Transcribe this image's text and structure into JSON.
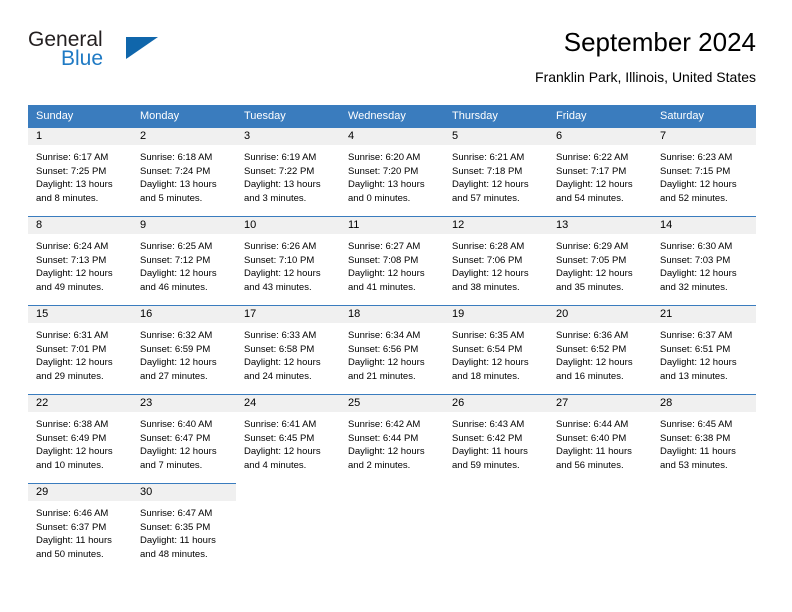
{
  "brand": {
    "name_part1": "General",
    "name_part2": "Blue",
    "triangle_color": "#1066ab",
    "blue_color": "#1f7ac4"
  },
  "header": {
    "title": "September 2024",
    "location": "Franklin Park, Illinois, United States"
  },
  "theme": {
    "header_bg": "#3a7cbe",
    "daynum_bg": "#f0f0f0",
    "cell_bg": "#ffffff",
    "text": "#000000"
  },
  "weekdays": [
    "Sunday",
    "Monday",
    "Tuesday",
    "Wednesday",
    "Thursday",
    "Friday",
    "Saturday"
  ],
  "weeks": [
    [
      {
        "day": "1",
        "sunrise": "Sunrise: 6:17 AM",
        "sunset": "Sunset: 7:25 PM",
        "daylight1": "Daylight: 13 hours",
        "daylight2": "and 8 minutes."
      },
      {
        "day": "2",
        "sunrise": "Sunrise: 6:18 AM",
        "sunset": "Sunset: 7:24 PM",
        "daylight1": "Daylight: 13 hours",
        "daylight2": "and 5 minutes."
      },
      {
        "day": "3",
        "sunrise": "Sunrise: 6:19 AM",
        "sunset": "Sunset: 7:22 PM",
        "daylight1": "Daylight: 13 hours",
        "daylight2": "and 3 minutes."
      },
      {
        "day": "4",
        "sunrise": "Sunrise: 6:20 AM",
        "sunset": "Sunset: 7:20 PM",
        "daylight1": "Daylight: 13 hours",
        "daylight2": "and 0 minutes."
      },
      {
        "day": "5",
        "sunrise": "Sunrise: 6:21 AM",
        "sunset": "Sunset: 7:18 PM",
        "daylight1": "Daylight: 12 hours",
        "daylight2": "and 57 minutes."
      },
      {
        "day": "6",
        "sunrise": "Sunrise: 6:22 AM",
        "sunset": "Sunset: 7:17 PM",
        "daylight1": "Daylight: 12 hours",
        "daylight2": "and 54 minutes."
      },
      {
        "day": "7",
        "sunrise": "Sunrise: 6:23 AM",
        "sunset": "Sunset: 7:15 PM",
        "daylight1": "Daylight: 12 hours",
        "daylight2": "and 52 minutes."
      }
    ],
    [
      {
        "day": "8",
        "sunrise": "Sunrise: 6:24 AM",
        "sunset": "Sunset: 7:13 PM",
        "daylight1": "Daylight: 12 hours",
        "daylight2": "and 49 minutes."
      },
      {
        "day": "9",
        "sunrise": "Sunrise: 6:25 AM",
        "sunset": "Sunset: 7:12 PM",
        "daylight1": "Daylight: 12 hours",
        "daylight2": "and 46 minutes."
      },
      {
        "day": "10",
        "sunrise": "Sunrise: 6:26 AM",
        "sunset": "Sunset: 7:10 PM",
        "daylight1": "Daylight: 12 hours",
        "daylight2": "and 43 minutes."
      },
      {
        "day": "11",
        "sunrise": "Sunrise: 6:27 AM",
        "sunset": "Sunset: 7:08 PM",
        "daylight1": "Daylight: 12 hours",
        "daylight2": "and 41 minutes."
      },
      {
        "day": "12",
        "sunrise": "Sunrise: 6:28 AM",
        "sunset": "Sunset: 7:06 PM",
        "daylight1": "Daylight: 12 hours",
        "daylight2": "and 38 minutes."
      },
      {
        "day": "13",
        "sunrise": "Sunrise: 6:29 AM",
        "sunset": "Sunset: 7:05 PM",
        "daylight1": "Daylight: 12 hours",
        "daylight2": "and 35 minutes."
      },
      {
        "day": "14",
        "sunrise": "Sunrise: 6:30 AM",
        "sunset": "Sunset: 7:03 PM",
        "daylight1": "Daylight: 12 hours",
        "daylight2": "and 32 minutes."
      }
    ],
    [
      {
        "day": "15",
        "sunrise": "Sunrise: 6:31 AM",
        "sunset": "Sunset: 7:01 PM",
        "daylight1": "Daylight: 12 hours",
        "daylight2": "and 29 minutes."
      },
      {
        "day": "16",
        "sunrise": "Sunrise: 6:32 AM",
        "sunset": "Sunset: 6:59 PM",
        "daylight1": "Daylight: 12 hours",
        "daylight2": "and 27 minutes."
      },
      {
        "day": "17",
        "sunrise": "Sunrise: 6:33 AM",
        "sunset": "Sunset: 6:58 PM",
        "daylight1": "Daylight: 12 hours",
        "daylight2": "and 24 minutes."
      },
      {
        "day": "18",
        "sunrise": "Sunrise: 6:34 AM",
        "sunset": "Sunset: 6:56 PM",
        "daylight1": "Daylight: 12 hours",
        "daylight2": "and 21 minutes."
      },
      {
        "day": "19",
        "sunrise": "Sunrise: 6:35 AM",
        "sunset": "Sunset: 6:54 PM",
        "daylight1": "Daylight: 12 hours",
        "daylight2": "and 18 minutes."
      },
      {
        "day": "20",
        "sunrise": "Sunrise: 6:36 AM",
        "sunset": "Sunset: 6:52 PM",
        "daylight1": "Daylight: 12 hours",
        "daylight2": "and 16 minutes."
      },
      {
        "day": "21",
        "sunrise": "Sunrise: 6:37 AM",
        "sunset": "Sunset: 6:51 PM",
        "daylight1": "Daylight: 12 hours",
        "daylight2": "and 13 minutes."
      }
    ],
    [
      {
        "day": "22",
        "sunrise": "Sunrise: 6:38 AM",
        "sunset": "Sunset: 6:49 PM",
        "daylight1": "Daylight: 12 hours",
        "daylight2": "and 10 minutes."
      },
      {
        "day": "23",
        "sunrise": "Sunrise: 6:40 AM",
        "sunset": "Sunset: 6:47 PM",
        "daylight1": "Daylight: 12 hours",
        "daylight2": "and 7 minutes."
      },
      {
        "day": "24",
        "sunrise": "Sunrise: 6:41 AM",
        "sunset": "Sunset: 6:45 PM",
        "daylight1": "Daylight: 12 hours",
        "daylight2": "and 4 minutes."
      },
      {
        "day": "25",
        "sunrise": "Sunrise: 6:42 AM",
        "sunset": "Sunset: 6:44 PM",
        "daylight1": "Daylight: 12 hours",
        "daylight2": "and 2 minutes."
      },
      {
        "day": "26",
        "sunrise": "Sunrise: 6:43 AM",
        "sunset": "Sunset: 6:42 PM",
        "daylight1": "Daylight: 11 hours",
        "daylight2": "and 59 minutes."
      },
      {
        "day": "27",
        "sunrise": "Sunrise: 6:44 AM",
        "sunset": "Sunset: 6:40 PM",
        "daylight1": "Daylight: 11 hours",
        "daylight2": "and 56 minutes."
      },
      {
        "day": "28",
        "sunrise": "Sunrise: 6:45 AM",
        "sunset": "Sunset: 6:38 PM",
        "daylight1": "Daylight: 11 hours",
        "daylight2": "and 53 minutes."
      }
    ],
    [
      {
        "day": "29",
        "sunrise": "Sunrise: 6:46 AM",
        "sunset": "Sunset: 6:37 PM",
        "daylight1": "Daylight: 11 hours",
        "daylight2": "and 50 minutes."
      },
      {
        "day": "30",
        "sunrise": "Sunrise: 6:47 AM",
        "sunset": "Sunset: 6:35 PM",
        "daylight1": "Daylight: 11 hours",
        "daylight2": "and 48 minutes."
      },
      {
        "day": "",
        "sunrise": "",
        "sunset": "",
        "daylight1": "",
        "daylight2": ""
      },
      {
        "day": "",
        "sunrise": "",
        "sunset": "",
        "daylight1": "",
        "daylight2": ""
      },
      {
        "day": "",
        "sunrise": "",
        "sunset": "",
        "daylight1": "",
        "daylight2": ""
      },
      {
        "day": "",
        "sunrise": "",
        "sunset": "",
        "daylight1": "",
        "daylight2": ""
      },
      {
        "day": "",
        "sunrise": "",
        "sunset": "",
        "daylight1": "",
        "daylight2": ""
      }
    ]
  ]
}
